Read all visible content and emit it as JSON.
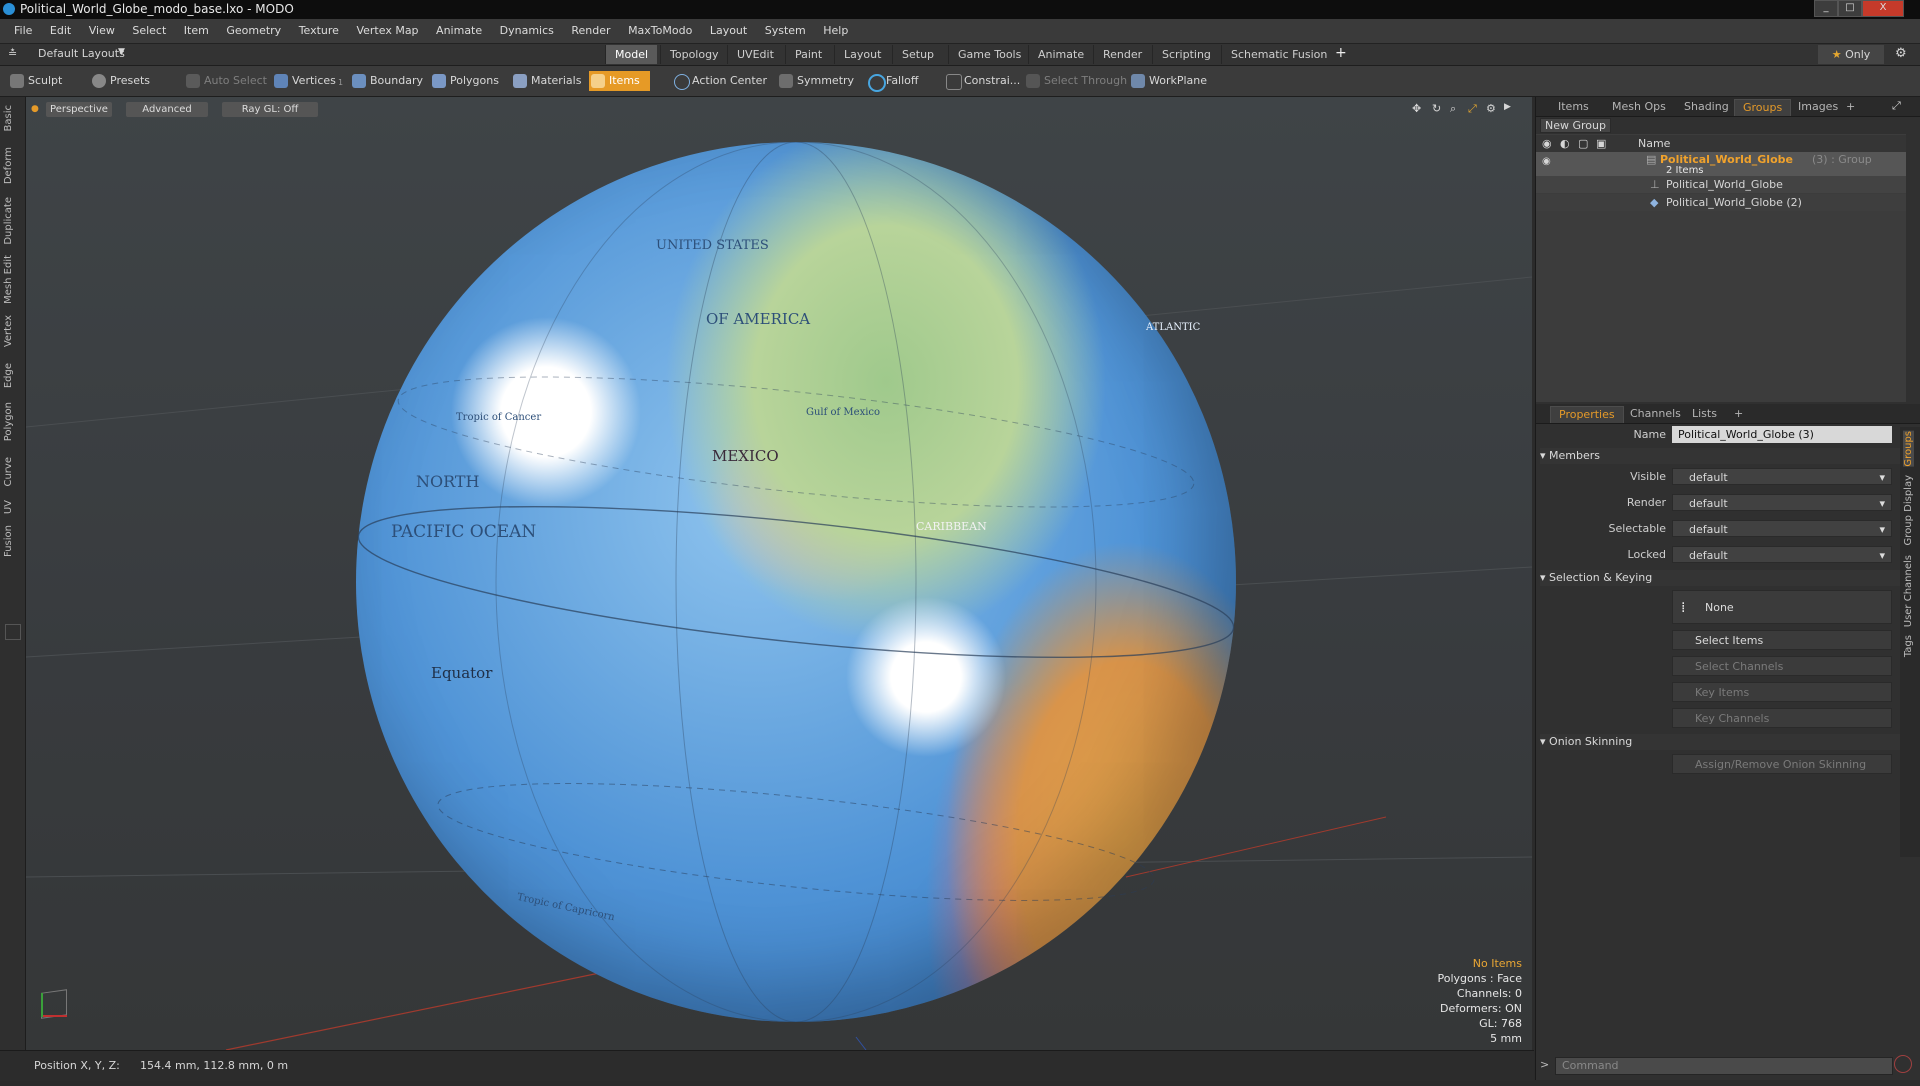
{
  "window": {
    "title": "Political_World_Globe_modo_base.lxo - MODO",
    "min": "_",
    "max": "□",
    "close": "X"
  },
  "menu": [
    "File",
    "Edit",
    "View",
    "Select",
    "Item",
    "Geometry",
    "Texture",
    "Vertex Map",
    "Animate",
    "Dynamics",
    "Render",
    "MaxToModo",
    "Layout",
    "System",
    "Help"
  ],
  "layout_bar": {
    "layouts_label": "Default Layouts",
    "tabs": [
      "Model",
      "Topology",
      "UVEdit",
      "Paint",
      "Layout",
      "Setup",
      "Game Tools",
      "Animate",
      "Render",
      "Scripting",
      "Schematic Fusion"
    ],
    "active_tab": "Model",
    "add": "+",
    "only_label": "Only"
  },
  "toolbar": {
    "sculpt": "Sculpt",
    "presets": "Presets",
    "auto_select": "Auto Select",
    "vertices": "Vertices",
    "vertices_count": "1",
    "boundary": "Boundary",
    "polygons": "Polygons",
    "materials": "Materials",
    "items": "Items",
    "action_center": "Action Center",
    "symmetry": "Symmetry",
    "falloff": "Falloff",
    "constraints": "Constrai...",
    "select_through": "Select Through",
    "workplane": "WorkPlane"
  },
  "left_tabs": [
    "Basic",
    "Deform",
    "Duplicate",
    "Mesh Edit",
    "Vertex",
    "Edge",
    "Polygon",
    "Curve",
    "UV",
    "Fusion"
  ],
  "viewport": {
    "view_mode": "Perspective",
    "shading": "Advanced",
    "raygl": "Ray GL: Off",
    "globe_labels": [
      "UNITED STATES",
      "OF AMERICA",
      "MEXICO",
      "Gulf of Mexico",
      "NORTH",
      "PACIFIC OCEAN",
      "Equator",
      "CARIBBEAN",
      "Tropic of Cancer",
      "Tropic of Capricorn",
      "ATLANTIC"
    ],
    "info": [
      "No Items",
      "Polygons : Face",
      "Channels: 0",
      "Deformers: ON",
      "GL: 768",
      "5 mm"
    ]
  },
  "groups_panel": {
    "tabs": [
      "Items",
      "Mesh Ops",
      "Shading",
      "Groups",
      "Images"
    ],
    "active_tab": "Groups",
    "add": "+",
    "new_group": "New Group",
    "column_name": "Name",
    "group_name": "Political_World_Globe",
    "group_suffix": "(3) : Group",
    "item_count": "2 Items",
    "children": [
      "Political_World_Globe",
      "Political_World_Globe (2)"
    ]
  },
  "properties_panel": {
    "tabs": [
      "Properties",
      "Channels",
      "Lists"
    ],
    "active_tab": "Properties",
    "add": "+",
    "side_tabs": [
      "Groups",
      "Group Display",
      "User Channels",
      "Tags"
    ],
    "name_label": "Name",
    "name_value": "Political_World_Globe (3)",
    "members_section": "Members",
    "fields": [
      {
        "label": "Visible",
        "value": "default"
      },
      {
        "label": "Render",
        "value": "default"
      },
      {
        "label": "Selectable",
        "value": "default"
      },
      {
        "label": "Locked",
        "value": "default"
      }
    ],
    "selection_section": "Selection & Keying",
    "none_button": "None",
    "buttons": [
      {
        "label": "Select Items",
        "enabled": true
      },
      {
        "label": "Select Channels",
        "enabled": false
      },
      {
        "label": "Key Items",
        "enabled": false
      },
      {
        "label": "Key Channels",
        "enabled": false
      }
    ],
    "onion_section": "Onion Skinning",
    "onion_button": "Assign/Remove Onion Skinning"
  },
  "status": {
    "position_label": "Position X, Y, Z:",
    "position_value": "154.4 mm, 112.8 mm, 0 m",
    "command_placeholder": "Command"
  },
  "colors": {
    "accent": "#e69a26",
    "viewport_bg": "#3b3f42",
    "panel_bg": "#303030"
  }
}
